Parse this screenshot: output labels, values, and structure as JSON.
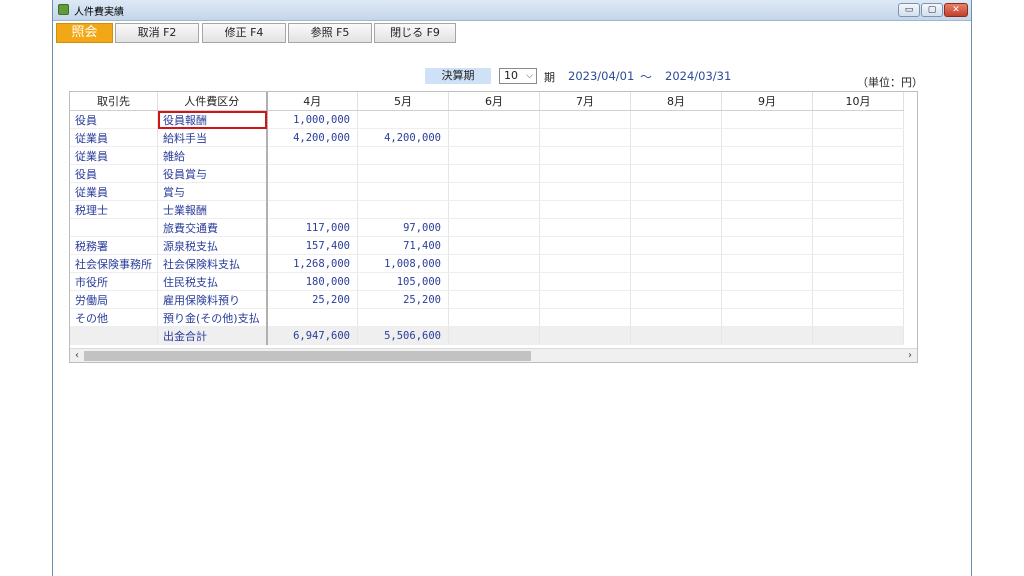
{
  "window": {
    "title": "人件費実績",
    "controls": {
      "minimize": "▭",
      "maximize": "▢",
      "close": "✕"
    }
  },
  "toolbar": {
    "buttons": [
      {
        "label": "照会",
        "active": true
      },
      {
        "label": "取消 F2"
      },
      {
        "label": "修正 F4"
      },
      {
        "label": "参照 F5"
      },
      {
        "label": "閉じる F9"
      }
    ]
  },
  "period": {
    "label": "決算期",
    "value": "10",
    "suffix": "期",
    "start": "2023/04/01",
    "tilde": "〜",
    "end": "2024/03/31"
  },
  "unit": "（単位：円）",
  "table": {
    "headers": [
      "取引先",
      "人件費区分",
      "4月",
      "5月",
      "6月",
      "7月",
      "8月",
      "9月",
      "10月"
    ],
    "rows": [
      [
        "役員",
        "役員報酬",
        "1,000,000",
        ""
      ],
      [
        "従業員",
        "給料手当",
        "4,200,000",
        "4,200,000"
      ],
      [
        "従業員",
        "雑給",
        "",
        ""
      ],
      [
        "役員",
        "役員賞与",
        "",
        ""
      ],
      [
        "従業員",
        "賞与",
        "",
        ""
      ],
      [
        "税理士",
        "士業報酬",
        "",
        ""
      ],
      [
        "",
        "旅費交通費",
        "117,000",
        "97,000"
      ],
      [
        "税務署",
        "源泉税支払",
        "157,400",
        "71,400"
      ],
      [
        "社会保険事務所",
        "社会保険料支払",
        "1,268,000",
        "1,008,000"
      ],
      [
        "市役所",
        "住民税支払",
        "180,000",
        "105,000"
      ],
      [
        "労働局",
        "雇用保険料預り",
        "25,200",
        "25,200"
      ],
      [
        "その他",
        "預り金(その他)支払",
        "",
        ""
      ],
      [
        "",
        "出金合計",
        "6,947,600",
        "5,506,600"
      ]
    ]
  },
  "scroll": {
    "left": "‹",
    "right": "›"
  },
  "colors": {
    "accent": "#f2a716",
    "text_value": "#2a3d9a",
    "selection": "#d01515"
  }
}
